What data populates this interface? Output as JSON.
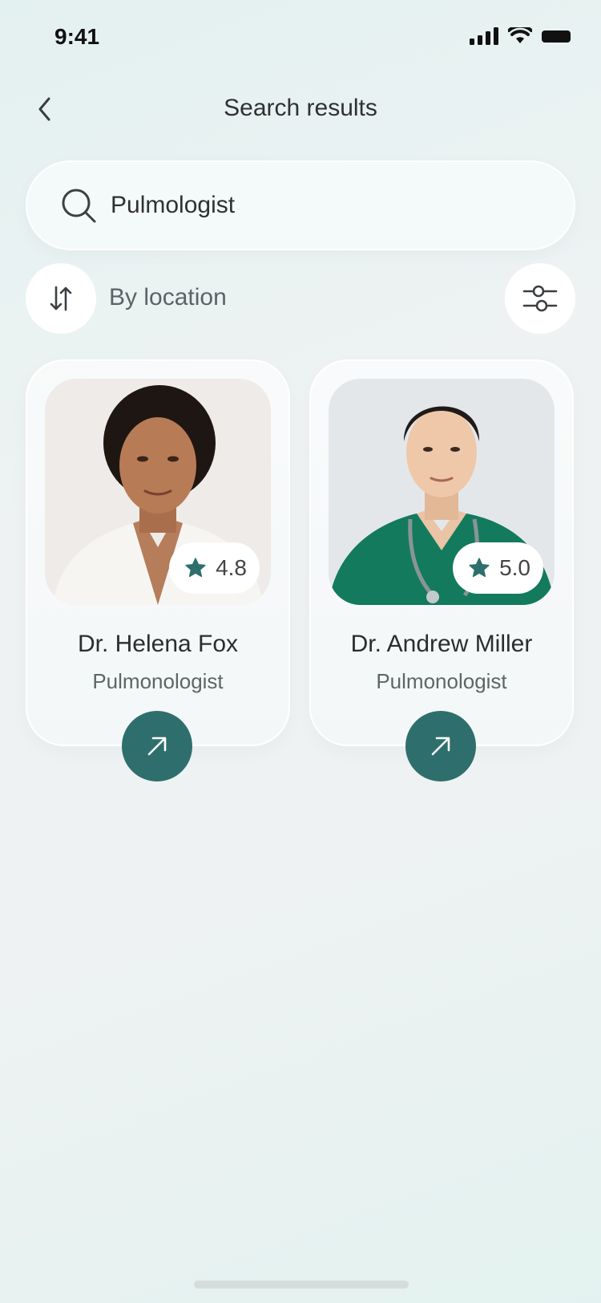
{
  "status_bar": {
    "time": "9:41"
  },
  "header": {
    "title": "Search results",
    "back_icon": "chevron-left-icon"
  },
  "search": {
    "value": "Pulmologist",
    "icon": "search-icon"
  },
  "sort": {
    "label": "By location",
    "icon": "sort-arrows-icon"
  },
  "filter": {
    "icon": "sliders-icon"
  },
  "colors": {
    "accent": "#2e6f6d",
    "background": "#eef2f2",
    "card": "#f6f9f9"
  },
  "doctors": [
    {
      "name": "Dr. Helena Fox",
      "specialty": "Pulmonologist",
      "rating": "4.8"
    },
    {
      "name": "Dr. Andrew Miller",
      "specialty": "Pulmonologist",
      "rating": "5.0"
    }
  ]
}
